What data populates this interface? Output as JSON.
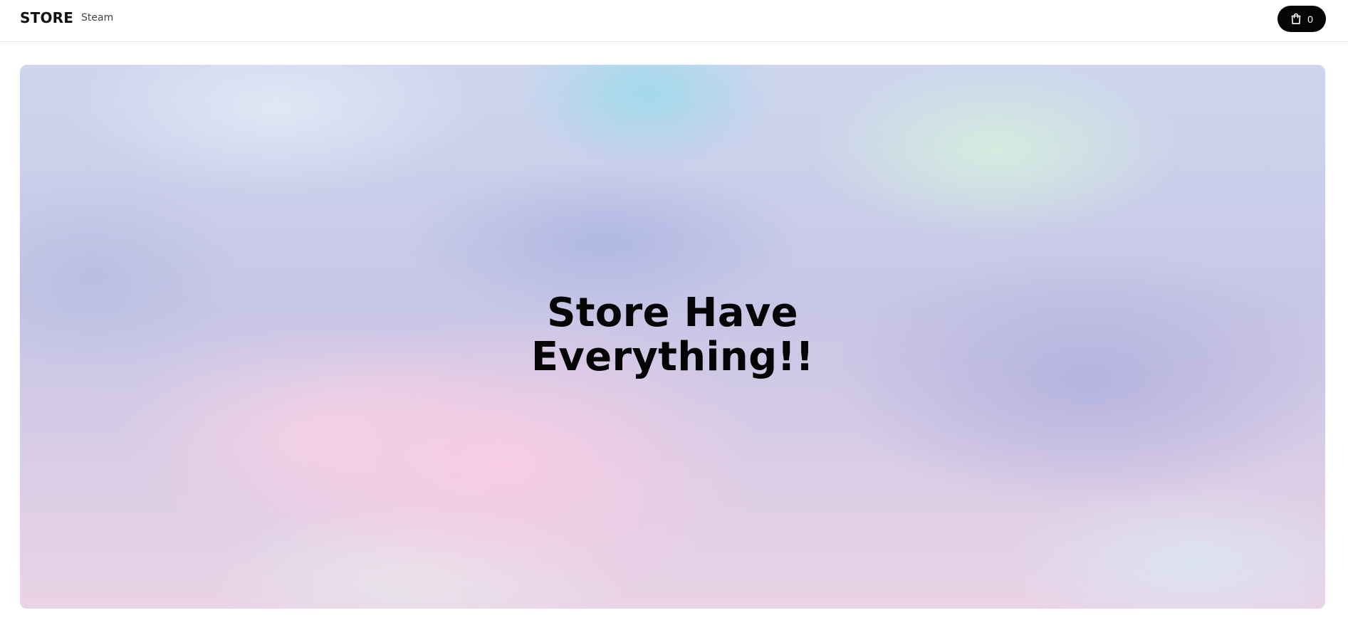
{
  "header": {
    "brand": "STORE",
    "nav": [
      {
        "label": "Steam"
      }
    ],
    "cart": {
      "icon": "shopping-bag-icon",
      "count": "0"
    }
  },
  "hero": {
    "title_line1": "Store Have",
    "title_line2": "Everything!!"
  },
  "colors": {
    "cart_button_bg": "#050505",
    "header_border": "#e6e6e6",
    "text": "#0b0b0b"
  }
}
